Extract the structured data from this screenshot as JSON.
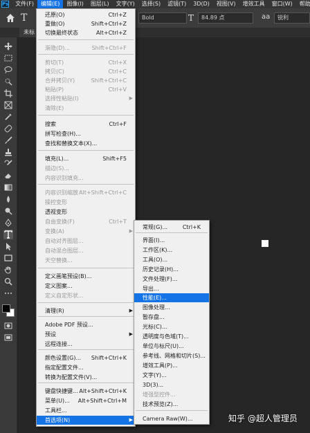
{
  "menubar": {
    "logo": "Ps",
    "items": [
      "文件(F)",
      "编辑(E)",
      "图像(I)",
      "图层(L)",
      "文字(Y)",
      "选择(S)",
      "滤镜(T)",
      "3D(D)",
      "视图(V)",
      "增效工具",
      "窗口(W)",
      "帮助(H)"
    ],
    "active_index": 1
  },
  "options": {
    "font_style": "Bold",
    "font_size": "84.89 点",
    "antialias": "锐利"
  },
  "document_tab": {
    "label": "未标"
  },
  "edit_menu": {
    "items": [
      {
        "label": "还原(O)",
        "shortcut": "Ctrl+Z",
        "disabled": false
      },
      {
        "label": "重做(O)",
        "shortcut": "Shift+Ctrl+Z",
        "disabled": false
      },
      {
        "label": "切换最终状态",
        "shortcut": "Alt+Ctrl+Z",
        "disabled": false
      },
      {
        "label": "渐隐(D)...",
        "shortcut": "Shift+Ctrl+F",
        "disabled": true
      },
      {
        "label": "剪切(T)",
        "shortcut": "Ctrl+X",
        "disabled": true
      },
      {
        "label": "拷贝(C)",
        "shortcut": "Ctrl+C",
        "disabled": true
      },
      {
        "label": "合并拷贝(Y)",
        "shortcut": "Shift+Ctrl+C",
        "disabled": true
      },
      {
        "label": "粘贴(P)",
        "shortcut": "Ctrl+V",
        "disabled": true
      },
      {
        "label": "选择性粘贴(I)",
        "shortcut": "",
        "disabled": true,
        "submenu": true
      },
      {
        "label": "清除(E)",
        "shortcut": "",
        "disabled": true
      },
      {
        "label": "搜索",
        "shortcut": "Ctrl+F",
        "disabled": false
      },
      {
        "label": "拼写检查(H)...",
        "shortcut": "",
        "disabled": false
      },
      {
        "label": "查找和替换文本(X)...",
        "shortcut": "",
        "disabled": false
      },
      {
        "label": "填充(L)...",
        "shortcut": "Shift+F5",
        "disabled": false
      },
      {
        "label": "描边(S)...",
        "shortcut": "",
        "disabled": true
      },
      {
        "label": "内容识别填充...",
        "shortcut": "",
        "disabled": true
      },
      {
        "label": "内容识别缩放",
        "shortcut": "Alt+Shift+Ctrl+C",
        "disabled": true
      },
      {
        "label": "操控变形",
        "shortcut": "",
        "disabled": true
      },
      {
        "label": "透视变形",
        "shortcut": "",
        "disabled": false
      },
      {
        "label": "自由变换(F)",
        "shortcut": "Ctrl+T",
        "disabled": true
      },
      {
        "label": "变换(A)",
        "shortcut": "",
        "disabled": true,
        "submenu": true
      },
      {
        "label": "自动对齐图层...",
        "shortcut": "",
        "disabled": true
      },
      {
        "label": "自动混合图层...",
        "shortcut": "",
        "disabled": true
      },
      {
        "label": "天空替换...",
        "shortcut": "",
        "disabled": true
      },
      {
        "label": "定义画笔预设(B)...",
        "shortcut": "",
        "disabled": false
      },
      {
        "label": "定义图案...",
        "shortcut": "",
        "disabled": false
      },
      {
        "label": "定义自定形状...",
        "shortcut": "",
        "disabled": true
      },
      {
        "label": "清理(R)",
        "shortcut": "",
        "disabled": false,
        "submenu": true
      },
      {
        "label": "Adobe PDF 预设...",
        "shortcut": "",
        "disabled": false
      },
      {
        "label": "预设",
        "shortcut": "",
        "disabled": false,
        "submenu": true
      },
      {
        "label": "远程连接...",
        "shortcut": "",
        "disabled": false
      },
      {
        "label": "颜色设置(G)...",
        "shortcut": "Shift+Ctrl+K",
        "disabled": false
      },
      {
        "label": "指定配置文件...",
        "shortcut": "",
        "disabled": false
      },
      {
        "label": "转换为配置文件(V)...",
        "shortcut": "",
        "disabled": false
      },
      {
        "label": "键盘快捷键...",
        "shortcut": "Alt+Shift+Ctrl+K",
        "disabled": false
      },
      {
        "label": "菜单(U)...",
        "shortcut": "Alt+Shift+Ctrl+M",
        "disabled": false
      },
      {
        "label": "工具栏...",
        "shortcut": "",
        "disabled": false
      },
      {
        "label": "首选项(N)",
        "shortcut": "",
        "disabled": false,
        "submenu": true,
        "highlight": true
      }
    ]
  },
  "pref_menu": {
    "items": [
      {
        "label": "常规(G)...",
        "shortcut": "Ctrl+K",
        "disabled": false
      },
      {
        "label": "界面(I)...",
        "shortcut": "",
        "disabled": false
      },
      {
        "label": "工作区(K)...",
        "shortcut": "",
        "disabled": false
      },
      {
        "label": "工具(O)...",
        "shortcut": "",
        "disabled": false
      },
      {
        "label": "历史记录(H)...",
        "shortcut": "",
        "disabled": false
      },
      {
        "label": "文件处理(F)...",
        "shortcut": "",
        "disabled": false
      },
      {
        "label": "导出...",
        "shortcut": "",
        "disabled": false
      },
      {
        "label": "性能(E)...",
        "shortcut": "",
        "disabled": false,
        "highlight": true
      },
      {
        "label": "图像处理...",
        "shortcut": "",
        "disabled": false
      },
      {
        "label": "暂存盘...",
        "shortcut": "",
        "disabled": false
      },
      {
        "label": "光标(C)...",
        "shortcut": "",
        "disabled": false
      },
      {
        "label": "透明度与色域(T)...",
        "shortcut": "",
        "disabled": false
      },
      {
        "label": "单位与标尺(U)...",
        "shortcut": "",
        "disabled": false
      },
      {
        "label": "参考线、网格和切片(S)...",
        "shortcut": "",
        "disabled": false
      },
      {
        "label": "增效工具(P)...",
        "shortcut": "",
        "disabled": false
      },
      {
        "label": "文字(Y)...",
        "shortcut": "",
        "disabled": false
      },
      {
        "label": "3D(3)...",
        "shortcut": "",
        "disabled": false
      },
      {
        "label": "增强型控件...",
        "shortcut": "",
        "disabled": true
      },
      {
        "label": "技术预览(Z)...",
        "shortcut": "",
        "disabled": false
      },
      {
        "label": "Camera Raw(W)...",
        "shortcut": "",
        "disabled": false
      }
    ]
  },
  "watermark": "知乎 @超人管理员",
  "colors": {
    "accent": "#1473e6",
    "menu_bg": "#f0f0f0",
    "app_bg": "#262626"
  }
}
